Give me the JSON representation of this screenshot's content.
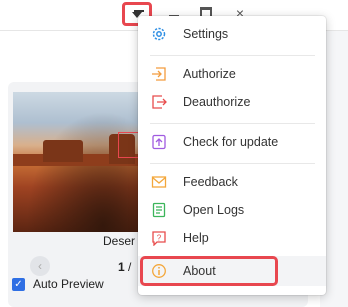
{
  "window": {
    "controls": [
      "dropdown-menu",
      "minimize",
      "maximize",
      "close"
    ],
    "close_glyph": "×"
  },
  "preview": {
    "image_label": "Deser",
    "page_current": "1",
    "page_sep": " /",
    "auto_preview_label": "Auto Preview",
    "auto_preview_checked": true,
    "prev_glyph": "‹"
  },
  "menu": {
    "items": [
      {
        "label": "Settings",
        "icon": "gear-icon",
        "color": "#2f8fe4"
      },
      {
        "label": "Authorize",
        "icon": "authorize-icon",
        "color": "#f39c3d"
      },
      {
        "label": "Deauthorize",
        "icon": "deauthorize-icon",
        "color": "#e84c4c"
      },
      {
        "label": "Check for update",
        "icon": "update-icon",
        "color": "#a05be0"
      },
      {
        "label": "Feedback",
        "icon": "mail-icon",
        "color": "#f3a73b"
      },
      {
        "label": "Open Logs",
        "icon": "document-icon",
        "color": "#3bb55a"
      },
      {
        "label": "Help",
        "icon": "help-icon",
        "color": "#e84c4c"
      },
      {
        "label": "About",
        "icon": "info-icon",
        "color": "#f3a73b"
      }
    ]
  },
  "colors": {
    "highlight_border": "#e8474f",
    "accent": "#2f6fe4"
  }
}
